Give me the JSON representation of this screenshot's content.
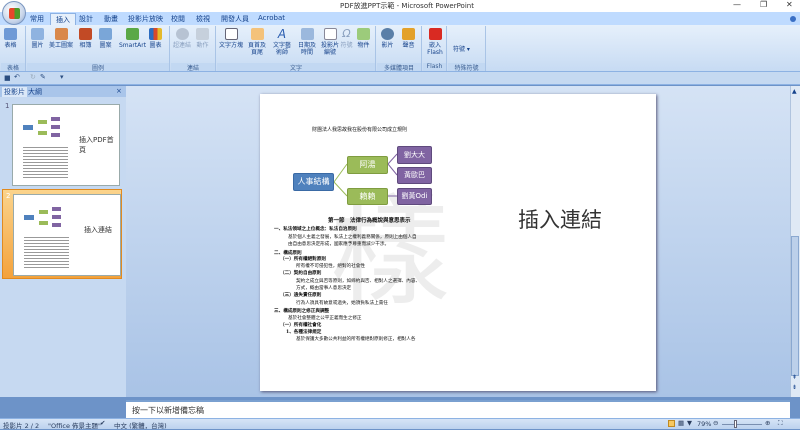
{
  "window": {
    "title": "PDF放進PPT示範 - Microsoft PowerPoint"
  },
  "tabs": [
    "常用",
    "插入",
    "設計",
    "動畫",
    "投影片放映",
    "校閱",
    "檢視",
    "開發人員",
    "Acrobat"
  ],
  "active_tab": "插入",
  "ribbon": {
    "groups": [
      {
        "label": "表格",
        "buttons": [
          "表格"
        ]
      },
      {
        "label": "圖例",
        "buttons": [
          "圖片",
          "美工圖案",
          "相簿",
          "圖案",
          "SmartArt",
          "圖表"
        ]
      },
      {
        "label": "連結",
        "buttons": [
          "超連結",
          "動作"
        ]
      },
      {
        "label": "文字",
        "buttons": [
          "文字方塊",
          "頁首及頁尾",
          "文字藝術師",
          "日期及時間",
          "投影片編號",
          "符號",
          "物件"
        ]
      },
      {
        "label": "多媒體項目",
        "buttons": [
          "影片",
          "聲音"
        ]
      },
      {
        "label": "Flash",
        "buttons": [
          "嵌入 Flash"
        ]
      },
      {
        "label": "特殊符號",
        "buttons": [
          "符號"
        ]
      }
    ]
  },
  "left_pane": {
    "tabs": [
      "投影片",
      "大綱"
    ],
    "close": "×",
    "slides": [
      {
        "num": "1",
        "label": "插入PDF首頁"
      },
      {
        "num": "2",
        "label": "插入連結"
      }
    ]
  },
  "slide": {
    "doc_title": "財團法人我思故我在股份有限公司成立規則",
    "chart": {
      "root": "人事結構",
      "level1": [
        "阿湯",
        "賴賴"
      ],
      "level2": [
        "劉大大",
        "黃歐巴",
        "劉黃Odi"
      ]
    },
    "doc_lines": [
      "第一節　法律行為概說與意思表示",
      "一、私法領域之上位概念：私法自治原則",
      "基於個人主義之發展，私法上之權利義務關係，原則上由個人自",
      "由自由意思決定形成，國家應予尊重而減少干涉。",
      "二、構成原則",
      "（一）所有權絕對原則",
      "所有權不可侵犯性，絕對的社會性",
      "（二）契約自由原則",
      "契約之成立與否等原則，如締約與否、相對人之選擇、內容、",
      "方式，概由當事人意思決定",
      "（三）過失責任原則",
      "行為人須具有故意或過失，始須負私法上責任",
      "三、構成原則之修正與調整",
      "基於社會整體之公平正義而生之修正",
      "（一）所有權社會化",
      "1、各種法律規定",
      "基於保護大多數公共利益的所有權絕對原則修正，相對人各"
    ],
    "heading": "插入連結"
  },
  "notes_placeholder": "按一下以新增備忘稿",
  "status": {
    "slide": "投影片 2 / 2",
    "theme": "\"Office 佈景主題\"",
    "language": "中文 (繁體，台灣)",
    "zoom": "79%",
    "zoom_percent": 79
  },
  "colors": {
    "blue": "#4f81bd",
    "green": "#9bbb59",
    "purple": "#8064a2",
    "ribbon": "#bfdbff"
  }
}
